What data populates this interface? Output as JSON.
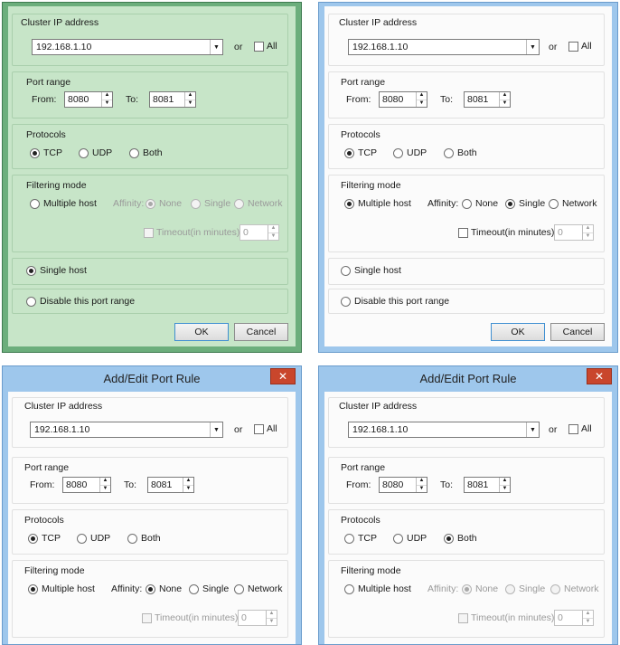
{
  "dialog": {
    "title": "Add/Edit Port Rule",
    "close_glyph": "✕",
    "cluster_ip_label": "Cluster IP address",
    "cluster_ip_value": "192.168.1.10",
    "or_label": "or",
    "all_label": "All",
    "port_range_label": "Port range",
    "from_label": "From:",
    "from_value": "8080",
    "to_label": "To:",
    "to_value": "8081",
    "protocols_label": "Protocols",
    "tcp_label": "TCP",
    "udp_label": "UDP",
    "both_label": "Both",
    "filtering_mode_label": "Filtering mode",
    "multiple_host_label": "Multiple host",
    "affinity_label": "Affinity:",
    "none_label": "None",
    "single_label": "Single",
    "network_label": "Network",
    "timeout_label": "Timeout(in minutes):",
    "timeout_value": "0",
    "single_host_label": "Single host",
    "disable_label": "Disable this port range",
    "ok_label": "OK",
    "cancel_label": "Cancel"
  },
  "icons": [
    "close-icon",
    "dropdown-arrow-icon",
    "spinner-up-icon",
    "spinner-down-icon"
  ],
  "colors": {
    "green_frame": "#6cae7c",
    "green_client": "#c7e5c8",
    "blue_frame": "#9ec7ec",
    "client": "#fbfbfb",
    "close_button": "#c9462c"
  },
  "dialogs": [
    {
      "id": "top-left",
      "protocol": "TCP",
      "filtering_mode": "Single host",
      "affinity": "None",
      "multiple_host_controls_enabled": false
    },
    {
      "id": "top-right",
      "protocol": "TCP",
      "filtering_mode": "Multiple host",
      "affinity": "Single",
      "multiple_host_controls_enabled": true
    },
    {
      "id": "bottom-left",
      "protocol": "TCP",
      "filtering_mode": "Multiple host",
      "affinity": "None",
      "multiple_host_controls_enabled": true
    },
    {
      "id": "bottom-right",
      "protocol": "Both",
      "filtering_mode": "Multiple host",
      "affinity": "None",
      "multiple_host_controls_enabled": false
    }
  ]
}
